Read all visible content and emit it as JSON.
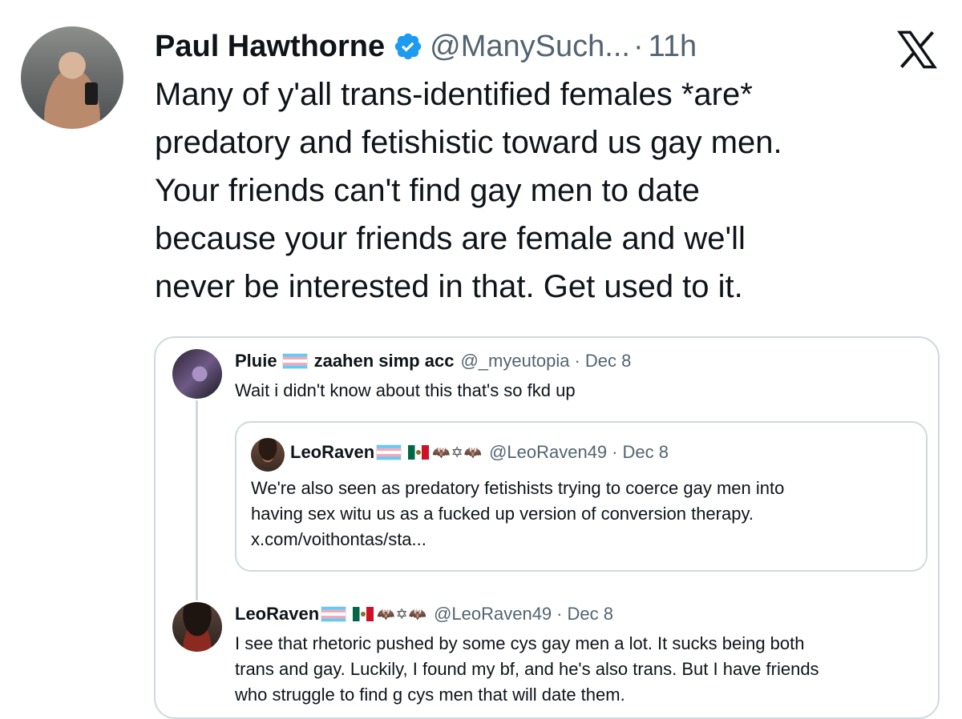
{
  "tweet": {
    "display_name": "Paul Hawthorne",
    "handle": "@ManySuch...",
    "dot": "·",
    "time": "11h",
    "text_lines": [
      "Many of y'all trans-identified females *are*",
      "predatory and fetishistic toward us gay men.",
      "Your friends can't find gay men to date",
      "because your friends are female and we'll",
      "never be interested in that. Get used to it."
    ]
  },
  "quote": {
    "reply1": {
      "name": "Pluie",
      "name_suffix": "zaahen simp acc",
      "handle": "@_myeutopia",
      "dot": "·",
      "date": "Dec 8",
      "text": "Wait i didn't know about this that's so fkd up"
    },
    "nested": {
      "name": "LeoRaven",
      "emoji_glyphs": "🦇✡🦇",
      "handle": "@LeoRaven49",
      "dot": "·",
      "date": "Dec 8",
      "text_lines": [
        "We're also seen as predatory fetishists trying to coerce gay men into",
        "having sex witu us as a fucked up version of conversion therapy.",
        "x.com/voithontas/sta..."
      ]
    },
    "reply2": {
      "name": "LeoRaven",
      "emoji_glyphs": "🦇✡🦇",
      "handle": "@LeoRaven49",
      "dot": "·",
      "date": "Dec 8",
      "text_lines": [
        "I see that rhetoric pushed by some cys gay men a lot. It sucks being both",
        "trans and gay. Luckily, I found my bf, and he's also trans. But I have  friends",
        "who struggle to find g cys men that will date them."
      ]
    }
  },
  "icons": {
    "verified": "verified-badge-icon",
    "brand": "x-logo-icon"
  },
  "colors": {
    "verified_blue": "#1d9bf0",
    "secondary_text": "#536471",
    "border": "#cfd9de"
  }
}
